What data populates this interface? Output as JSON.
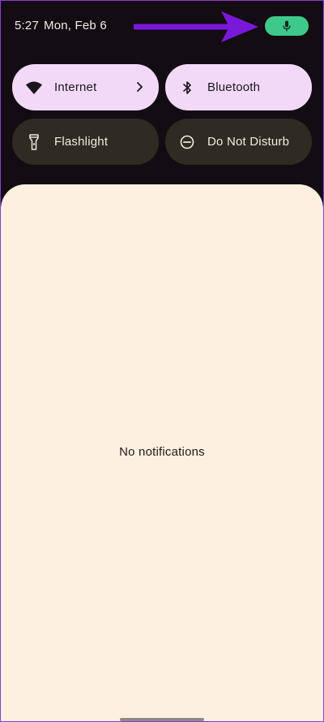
{
  "status_bar": {
    "time": "5:27",
    "date": "Mon, Feb 6",
    "mic_indicator_icon": "microphone-icon",
    "mic_indicator_color": "#3ec98a"
  },
  "annotation": {
    "arrow_color": "#7a18d9"
  },
  "quick_settings": {
    "tiles": [
      {
        "label": "Internet",
        "icon": "wifi-icon",
        "state": "on",
        "has_chevron": true
      },
      {
        "label": "Bluetooth",
        "icon": "bluetooth-icon",
        "state": "on"
      },
      {
        "label": "Flashlight",
        "icon": "flashlight-icon",
        "state": "off"
      },
      {
        "label": "Do Not Disturb",
        "icon": "do-not-disturb-icon",
        "state": "off"
      }
    ]
  },
  "notifications": {
    "empty_text": "No notifications"
  },
  "colors": {
    "tile_on": "#f2d9f8",
    "tile_off": "#2f2a22",
    "panel_bg": "#fdf0e0",
    "shade_bg": "#130c12"
  }
}
